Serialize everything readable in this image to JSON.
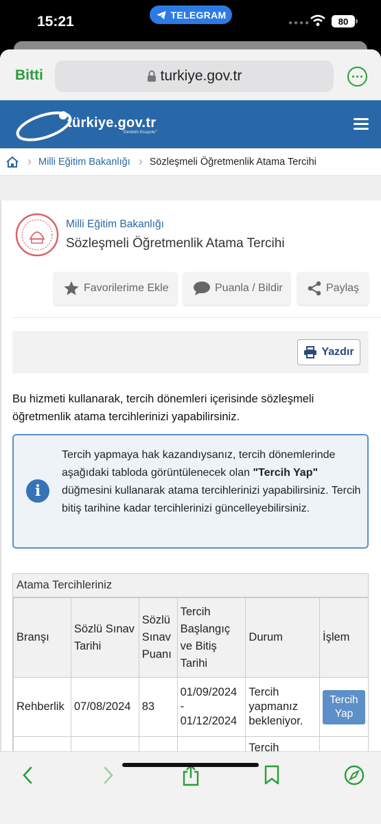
{
  "status_bar": {
    "time": "15:21",
    "notice_app": "TELEGRAM",
    "battery": "80"
  },
  "browser": {
    "done_label": "Bitti",
    "url": "turkiye.gov.tr",
    "accent": "#2a9d3a"
  },
  "site": {
    "logo_text": "türkiye.gov.tr",
    "logo_tagline": "\"Devletin Kısayolu\"",
    "brand_color": "#2968a8"
  },
  "breadcrumb": {
    "items": [
      "Milli Eğitim Bakanlığı",
      "Sözleşmeli Öğretmenlik Atama Tercihi"
    ]
  },
  "service": {
    "org": "Milli Eğitim Bakanlığı",
    "title": "Sözleşmeli Öğretmenlik Atama Tercihi",
    "actions": {
      "favorite": "Favorilerime Ekle",
      "rate": "Puanla / Bildir",
      "share": "Paylaş"
    },
    "print": "Yazdır"
  },
  "intro": "Bu hizmeti kullanarak, tercih dönemleri içerisinde sözleşmeli öğretmenlik atama tercihlerinizi yapabilirsiniz.",
  "info": {
    "before": "Tercih yapmaya hak kazandıysanız, tercih dönemlerinde aşağıdaki tabloda görüntülenecek olan ",
    "bold": "\"Tercih Yap\"",
    "after": " düğmesini kullanarak atama tercihlerinizi yapabilirsiniz. Tercih bitiş tarihine kadar tercihlerinizi güncelleyebilirsiniz."
  },
  "table": {
    "caption": "Atama Tercihleriniz",
    "headers": [
      "Branşı",
      "Sözlü Sınav Tarihi",
      "Sözlü Sınav Puanı",
      "Tercih Başlangıç ve Bitiş Tarihi",
      "Durum",
      "İşlem"
    ],
    "rows": [
      {
        "brans": "Rehberlik",
        "sinav_tarihi": "07/08/2024",
        "puan": "83",
        "baslangic": "01/09/2024",
        "tire": "-",
        "bitis": "01/12/2024",
        "durum": "Tercih yapmanız bekleniyor.",
        "islem": "Tercih Yap"
      },
      {
        "durum_partial": "Tercih"
      }
    ]
  }
}
